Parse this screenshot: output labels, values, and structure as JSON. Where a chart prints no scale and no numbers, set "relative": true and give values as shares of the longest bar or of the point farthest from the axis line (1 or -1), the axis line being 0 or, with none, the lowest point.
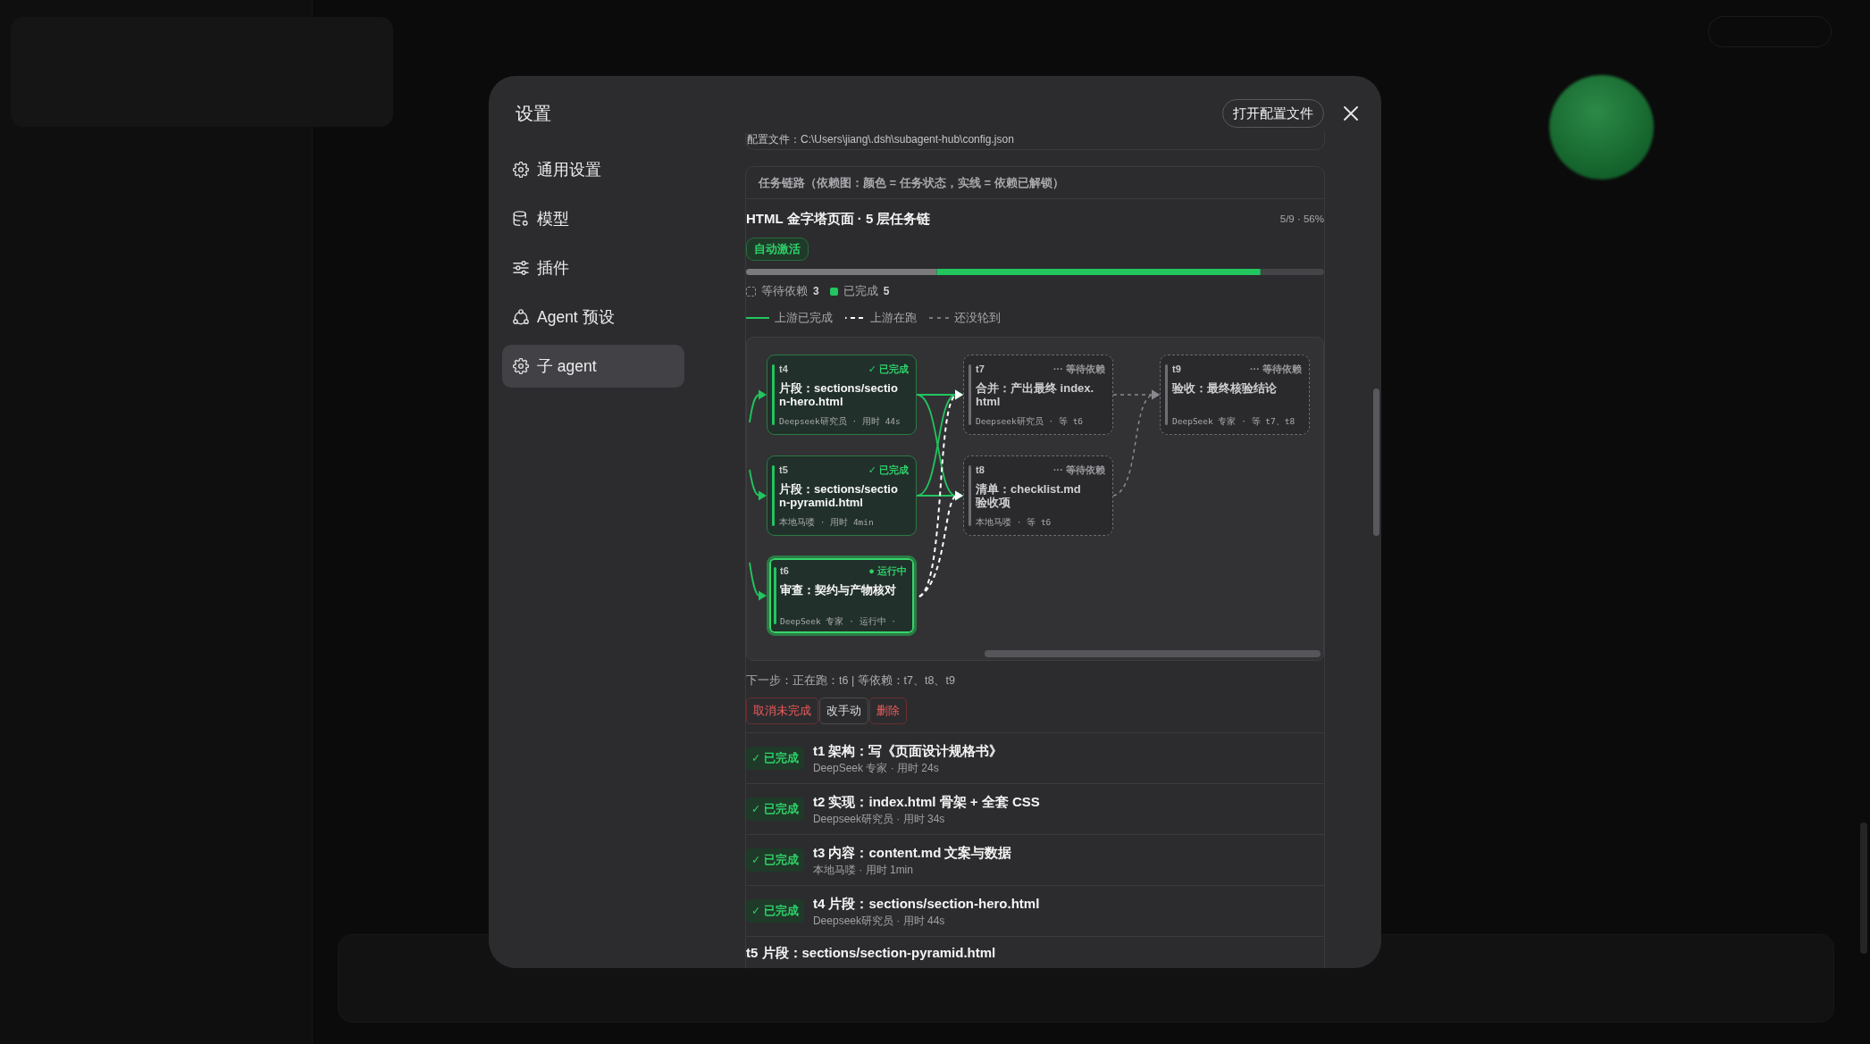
{
  "dialog": {
    "title": "设置",
    "open_config_button": "打开配置文件"
  },
  "sidebar": {
    "items": [
      {
        "label": "通用设置",
        "selected": false
      },
      {
        "label": "模型",
        "selected": false
      },
      {
        "label": "插件",
        "selected": false
      },
      {
        "label": "Agent 预设",
        "selected": false
      },
      {
        "label": "子 agent",
        "selected": true
      }
    ]
  },
  "config_file": "配置文件：C:\\Users\\jiang\\.dsh\\subagent-hub\\config.json",
  "task_chain": {
    "header": "任务链路（依赖图：颜色 = 任务状态，实线 = 依赖已解锁）",
    "title": "HTML 金字塔页面 · 5 层任务链",
    "progress_text": "5/9 · 56%",
    "badge": "自动激活",
    "progress_bar": {
      "chart_data": {
        "type": "bar",
        "orientation": "horizontal",
        "stacked": true,
        "relative": true,
        "series": [
          {
            "color": "#7a7a7a",
            "values": [
              0.33
            ]
          },
          {
            "color": "#22c55e",
            "values": [
              0.56
            ]
          },
          {
            "color": "#454549",
            "values": [
              0.11
            ]
          }
        ]
      }
    },
    "status_legend": [
      {
        "kind": "waiting",
        "label": "等待依赖",
        "count": "3"
      },
      {
        "kind": "done",
        "label": "已完成",
        "count": "5"
      }
    ],
    "line_legend": [
      {
        "kind": "done",
        "label": "上游已完成"
      },
      {
        "kind": "running",
        "label": "上游在跑"
      },
      {
        "kind": "waiting",
        "label": "还没轮到"
      }
    ],
    "graph": {
      "nodes": [
        {
          "id": "t4",
          "kind": "done",
          "status_label": "✓ 已完成",
          "title": "片段：sections/section-hero.html",
          "meta": "Deepseek研究员 · 用时 44s"
        },
        {
          "id": "t5",
          "kind": "done",
          "status_label": "✓ 已完成",
          "title": "片段：sections/section-pyramid.html",
          "meta": "本地马喽 · 用时 4min"
        },
        {
          "id": "t6",
          "kind": "running",
          "status_label": "● 运行中",
          "title": "审查：契约与产物核对",
          "meta": "DeepSeek 专家 · 运行中 ·"
        },
        {
          "id": "t7",
          "kind": "waiting",
          "status_label": "··· 等待依赖",
          "title": "合并：产出最终 index.html",
          "meta": "Deepseek研究员 · 等 t6"
        },
        {
          "id": "t8",
          "kind": "waiting",
          "status_label": "··· 等待依赖",
          "title": "清单：checklist.md 验收项",
          "meta": "本地马喽 · 等 t6"
        },
        {
          "id": "t9",
          "kind": "waiting",
          "status_label": "··· 等待依赖",
          "title": "验收：最终核验结论",
          "meta": "DeepSeek 专家 · 等 t7、t8"
        }
      ],
      "edges": [
        {
          "kind": "done"
        },
        {
          "kind": "done"
        },
        {
          "kind": "done"
        },
        {
          "kind": "done"
        },
        {
          "kind": "running"
        },
        {
          "kind": "running"
        },
        {
          "kind": "waiting"
        },
        {
          "kind": "waiting"
        },
        {
          "kind": "done"
        },
        {
          "kind": "done"
        },
        {
          "kind": "done"
        }
      ]
    },
    "next_step": "下一步：正在跑：t6 | 等依赖：t7、t8、t9",
    "actions": [
      {
        "label": "取消未完成",
        "kind": "danger"
      },
      {
        "label": "改手动",
        "kind": "neutral"
      },
      {
        "label": "删除",
        "kind": "danger"
      }
    ],
    "tasks": [
      {
        "kind": "done",
        "badge": "✓ 已完成",
        "title": "t1 架构：写《页面设计规格书》",
        "meta": "DeepSeek 专家 · 用时 24s"
      },
      {
        "kind": "done",
        "badge": "✓ 已完成",
        "title": "t2 实现：index.html 骨架 + 全套 CSS",
        "meta": "Deepseek研究员 · 用时 34s"
      },
      {
        "kind": "done",
        "badge": "✓ 已完成",
        "title": "t3 内容：content.md 文案与数据",
        "meta": "本地马喽 · 用时 1min"
      },
      {
        "kind": "done",
        "badge": "✓ 已完成",
        "title": "t4 片段：sections/section-hero.html",
        "meta": "Deepseek研究员 · 用时 44s"
      },
      {
        "title": "t5 片段：sections/section-pyramid.html"
      }
    ]
  }
}
